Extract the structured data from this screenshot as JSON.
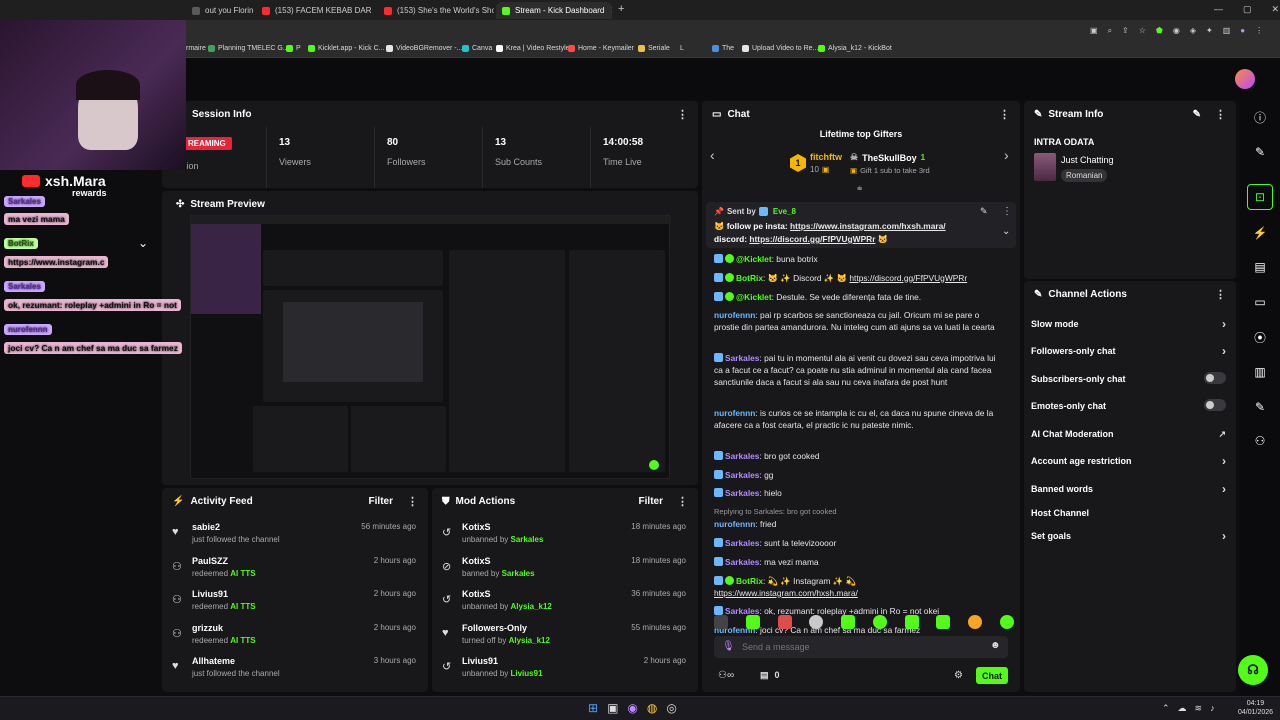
{
  "browser": {
    "tabs": [
      {
        "title": "out you Florin Puric...",
        "active": false,
        "color": "#5a5a5a"
      },
      {
        "title": "(153) FACEM KEBAB DAR CU A...",
        "active": false,
        "color": "#ff2b2b"
      },
      {
        "title": "(153) She's the World's Shorte...",
        "active": false,
        "color": "#ff2b2b"
      },
      {
        "title": "Stream - Kick Dashboard",
        "active": true,
        "color": "#53fc18"
      }
    ],
    "new_tab": "+",
    "window_controls": [
      "—",
      "▢",
      "✕"
    ],
    "bookmarks": [
      "rmaire",
      "Planning TMELEC G...",
      "P",
      "Kicklet.app - Kick C...",
      "VideoBGRemover -...",
      "Canva",
      "Krea | Video Restyle",
      "Home - Keymailer",
      "Seriale",
      "L",
      "The",
      "Upload Video to Re...",
      "Alysia_k12 - KickBot"
    ]
  },
  "overlay": {
    "streamer_name": "xsh.Mara",
    "rewards_label": "rewards",
    "messages": [
      {
        "user": "Sarkales",
        "text": "ma vezi mama"
      },
      {
        "user": "BotRix",
        "text": "https://www.instagram.c"
      },
      {
        "user": "Sarkales",
        "text": "ok, rezumant: roleplay +admini in Ro = not"
      },
      {
        "user": "nurofennn",
        "text": "joci cv? Ca n am chef sa ma duc sa farmez"
      }
    ]
  },
  "session": {
    "title": "Session Info",
    "status_badge": "REAMING",
    "session_label": "sion",
    "stats": [
      {
        "value": "13",
        "label": "Viewers"
      },
      {
        "value": "80",
        "label": "Followers"
      },
      {
        "value": "13",
        "label": "Sub Counts"
      },
      {
        "value": "14:00:58",
        "label": "Time Live"
      }
    ]
  },
  "stream_preview": {
    "title": "Stream Preview"
  },
  "activity_feed": {
    "title": "Activity Feed",
    "filter_label": "Filter",
    "items": [
      {
        "name": "sabie2",
        "action": "just followed the channel",
        "highlight": "",
        "time": "56 minutes ago",
        "icon": "heart-icon"
      },
      {
        "name": "PaulSZZ",
        "action": "redeemed ",
        "highlight": "AI TTS",
        "time": "2 hours ago",
        "icon": "redeem-icon"
      },
      {
        "name": "Livius91",
        "action": "redeemed ",
        "highlight": "AI TTS",
        "time": "2 hours ago",
        "icon": "redeem-icon"
      },
      {
        "name": "grizzuk",
        "action": "redeemed ",
        "highlight": "AI TTS",
        "time": "2 hours ago",
        "icon": "redeem-icon"
      },
      {
        "name": "Allhateme",
        "action": "just followed the channel",
        "highlight": "",
        "time": "3 hours ago",
        "icon": "heart-icon"
      }
    ]
  },
  "mod_actions": {
    "title": "Mod Actions",
    "filter_label": "Filter",
    "items": [
      {
        "name": "KotixS",
        "action": "unbanned by ",
        "by": "Sarkales",
        "time": "18 minutes ago",
        "icon": "undo-icon"
      },
      {
        "name": "KotixS",
        "action": "banned by ",
        "by": "Sarkales",
        "time": "18 minutes ago",
        "icon": "ban-icon"
      },
      {
        "name": "KotixS",
        "action": "unbanned by ",
        "by": "Alysia_k12",
        "time": "36 minutes ago",
        "icon": "undo-icon"
      },
      {
        "name": "Followers-Only",
        "action": "turned off by ",
        "by": "Alysia_k12",
        "time": "55 minutes ago",
        "icon": "heart-icon"
      },
      {
        "name": "Livius91",
        "action": "unbanned by ",
        "by": "Livius91",
        "time": "2 hours ago",
        "icon": "undo-icon"
      }
    ]
  },
  "chat": {
    "title": "Chat",
    "gifters_title": "Lifetime top Gifters",
    "gifter_rank": "1",
    "gifter_name": "fitchftw",
    "gifter_count": "10",
    "gifter2_name": "TheSkullBoy",
    "gifter2_count": "1",
    "gifter2_note": "Gift 1 sub to take 3rd",
    "pinned_label": "Sent by",
    "pinned_user": "Eve_8",
    "pinned_text_1": "follow pe insta: ",
    "pinned_link_1": "https://www.instagram.com/hxsh.mara/",
    "pinned_text_2": "discord: ",
    "pinned_link_2": "https://discord.gg/FfPVUgWPRr",
    "messages": [
      {
        "user": "@Kicklet",
        "cls": "green",
        "text": ": buna botrix"
      },
      {
        "user": "BotRix",
        "cls": "green",
        "text": ": 🐱 ✨ Discord ✨ 🐱 ",
        "link": "https://discord.gg/FfPVUgWPRr"
      },
      {
        "user": "@Kicklet",
        "cls": "green",
        "text": ": Destule. Se vede diferența fata de tine."
      },
      {
        "user": "nurofennn",
        "cls": "blue",
        "text": ": pai rp scarbos se sanctioneaza cu jail. Oricum mi se pare o prostie din partea amandurora. Nu inteleg cum ati ajuns sa va luati la cearta"
      },
      {
        "user": "Sarkales",
        "cls": "purple",
        "text": ": pai tu in momentul ala ai venit cu dovezi sau ceva impotriva lui ca a facut ce a facut? ca poate nu stia adminul in momentul ala cand facea sanctiunile daca a facut si ala sau nu ceva inafara de post hunt"
      },
      {
        "user": "nurofennn",
        "cls": "blue",
        "text": ": is curios ce se intampla ic cu el, ca daca nu spune cineva de la afacere ca a fost cearta, el practic ic nu pateste nimic."
      },
      {
        "user": "Sarkales",
        "cls": "purple",
        "text": ": bro got cooked"
      },
      {
        "user": "Sarkales",
        "cls": "purple",
        "text": ": gg"
      },
      {
        "user": "Sarkales",
        "cls": "purple",
        "text": ": hielo"
      },
      {
        "user": "nurofennn",
        "cls": "blue",
        "text": ": fried",
        "reply": "Replying to Sarkales: bro got cooked"
      },
      {
        "user": "Sarkales",
        "cls": "purple",
        "text": ": sunt la televizoooor"
      },
      {
        "user": "Sarkales",
        "cls": "purple",
        "text": ": ma vezi mama"
      },
      {
        "user": "BotRix",
        "cls": "green",
        "text": ": 💫 ✨ Instagram ✨ 💫",
        "link2": "https://www.instagram.com/hxsh.mara/"
      },
      {
        "user": "Sarkales",
        "cls": "purple",
        "text": ": ok, rezumant: roleplay +admini in Ro = not okei"
      },
      {
        "user": "nurofennn",
        "cls": "blue",
        "text": ": joci cv? Ca n am chef sa ma duc sa farmez"
      }
    ],
    "input_placeholder": "Send a message",
    "count_value": "0",
    "chat_button": "Chat"
  },
  "stream_info": {
    "title": "Stream Info",
    "stream_title": "INTRA ODATA",
    "category": "Just Chatting",
    "language": "Romanian"
  },
  "channel_actions": {
    "title": "Channel Actions",
    "items": [
      {
        "label": "Slow mode",
        "control": "chevron"
      },
      {
        "label": "Followers-only chat",
        "control": "chevron"
      },
      {
        "label": "Subscribers-only chat",
        "control": "toggle"
      },
      {
        "label": "Emotes-only chat",
        "control": "toggle"
      },
      {
        "label": "AI Chat Moderation",
        "control": "external"
      },
      {
        "label": "Account age restriction",
        "control": "chevron"
      },
      {
        "label": "Banned words",
        "control": "chevron"
      },
      {
        "label": "Host Channel",
        "control": "none"
      },
      {
        "label": "Set goals",
        "control": "chevron"
      }
    ]
  },
  "taskbar": {
    "time": "04:19",
    "date": "04/01/2026"
  },
  "colors": {
    "accent": "#53fc18",
    "panel": "#18181b",
    "bg": "#0d0d0f"
  }
}
